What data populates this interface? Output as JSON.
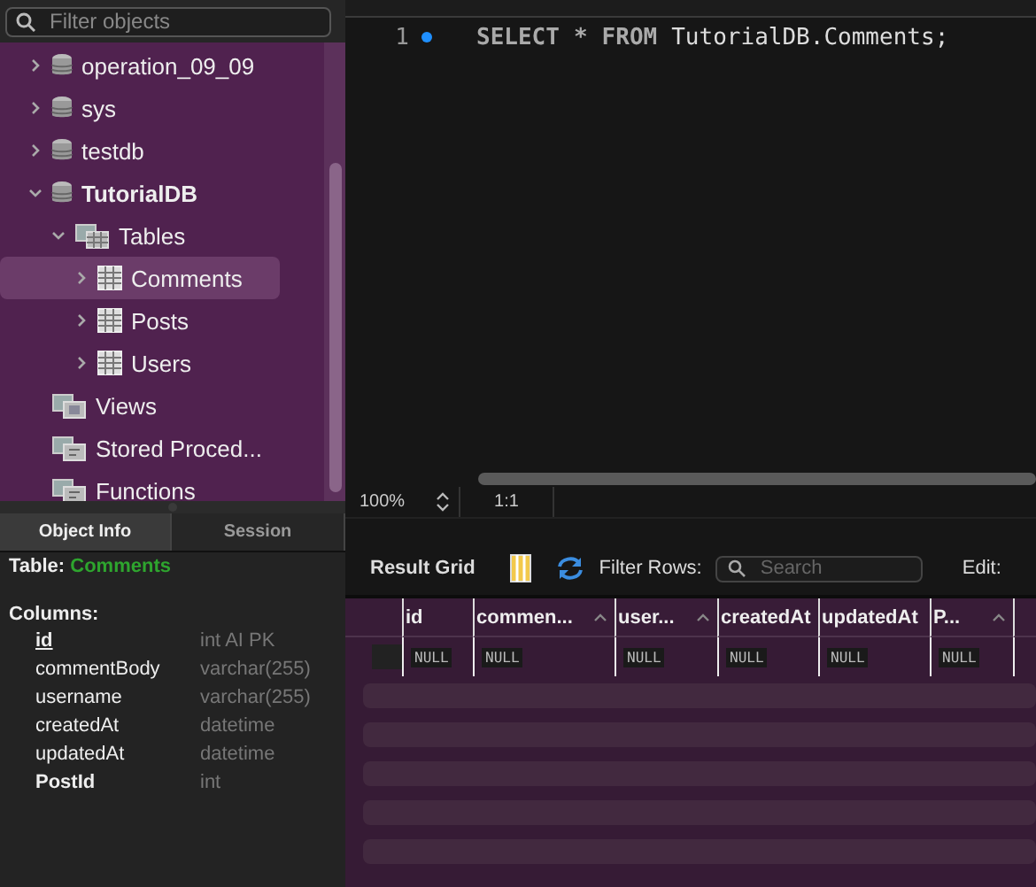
{
  "sidebar": {
    "filter": {
      "placeholder": "Filter objects"
    },
    "tree": [
      {
        "label": "operation_09_09",
        "kind": "schema",
        "expanded": false,
        "active": false,
        "selected": false
      },
      {
        "label": "sys",
        "kind": "schema",
        "expanded": false,
        "active": false,
        "selected": false
      },
      {
        "label": "testdb",
        "kind": "schema",
        "expanded": false,
        "active": false,
        "selected": false
      },
      {
        "label": "TutorialDB",
        "kind": "schema",
        "expanded": true,
        "active": true,
        "selected": false,
        "children": [
          {
            "label": "Tables",
            "kind": "tables",
            "expanded": true,
            "selected": false,
            "children": [
              {
                "label": "Comments",
                "kind": "table",
                "expanded": false,
                "selected": true
              },
              {
                "label": "Posts",
                "kind": "table",
                "expanded": false,
                "selected": false
              },
              {
                "label": "Users",
                "kind": "table",
                "expanded": false,
                "selected": false
              }
            ]
          },
          {
            "label": "Views",
            "kind": "views",
            "selected": false
          },
          {
            "label": "Stored Proced...",
            "kind": "routines",
            "selected": false
          },
          {
            "label": "Functions",
            "kind": "routines",
            "selected": false
          }
        ]
      }
    ]
  },
  "info_tabs": [
    {
      "label": "Object Info",
      "selected": true
    },
    {
      "label": "Session",
      "selected": false
    }
  ],
  "object_info": {
    "table_label": "Table:",
    "table_name": "Comments",
    "columns_label": "Columns:",
    "columns": [
      {
        "name": "id",
        "type": "int AI PK",
        "kind": "primary"
      },
      {
        "name": "commentBody",
        "type": "varchar(255)",
        "kind": "plain"
      },
      {
        "name": "username",
        "type": "varchar(255)",
        "kind": "plain"
      },
      {
        "name": "createdAt",
        "type": "datetime",
        "kind": "plain"
      },
      {
        "name": "updatedAt",
        "type": "datetime",
        "kind": "plain"
      },
      {
        "name": "PostId",
        "type": "int",
        "kind": "foreign"
      }
    ]
  },
  "editor": {
    "lines": [
      {
        "number": "1",
        "marker": true,
        "tokens": [
          {
            "text": "SELECT",
            "kind": "keyword"
          },
          {
            "text": "*",
            "kind": "keyword"
          },
          {
            "text": "FROM",
            "kind": "keyword"
          },
          {
            "text": "TutorialDB.Comments;",
            "kind": "ident"
          }
        ]
      }
    ],
    "zoom": "100%",
    "position": "1:1"
  },
  "result": {
    "title": "Result Grid",
    "filter_label": "Filter Rows:",
    "search": {
      "placeholder": "Search"
    },
    "edit_label": "Edit:",
    "columns": [
      {
        "label": "id",
        "sort_icon": false
      },
      {
        "label": "commen...",
        "sort_icon": true
      },
      {
        "label": "user...",
        "sort_icon": true
      },
      {
        "label": "createdAt",
        "sort_icon": false
      },
      {
        "label": "updatedAt",
        "sort_icon": false
      },
      {
        "label": "P...",
        "sort_icon": true
      }
    ],
    "rows": [
      [
        "NULL",
        "NULL",
        "NULL",
        "NULL",
        "NULL",
        "NULL"
      ]
    ]
  }
}
